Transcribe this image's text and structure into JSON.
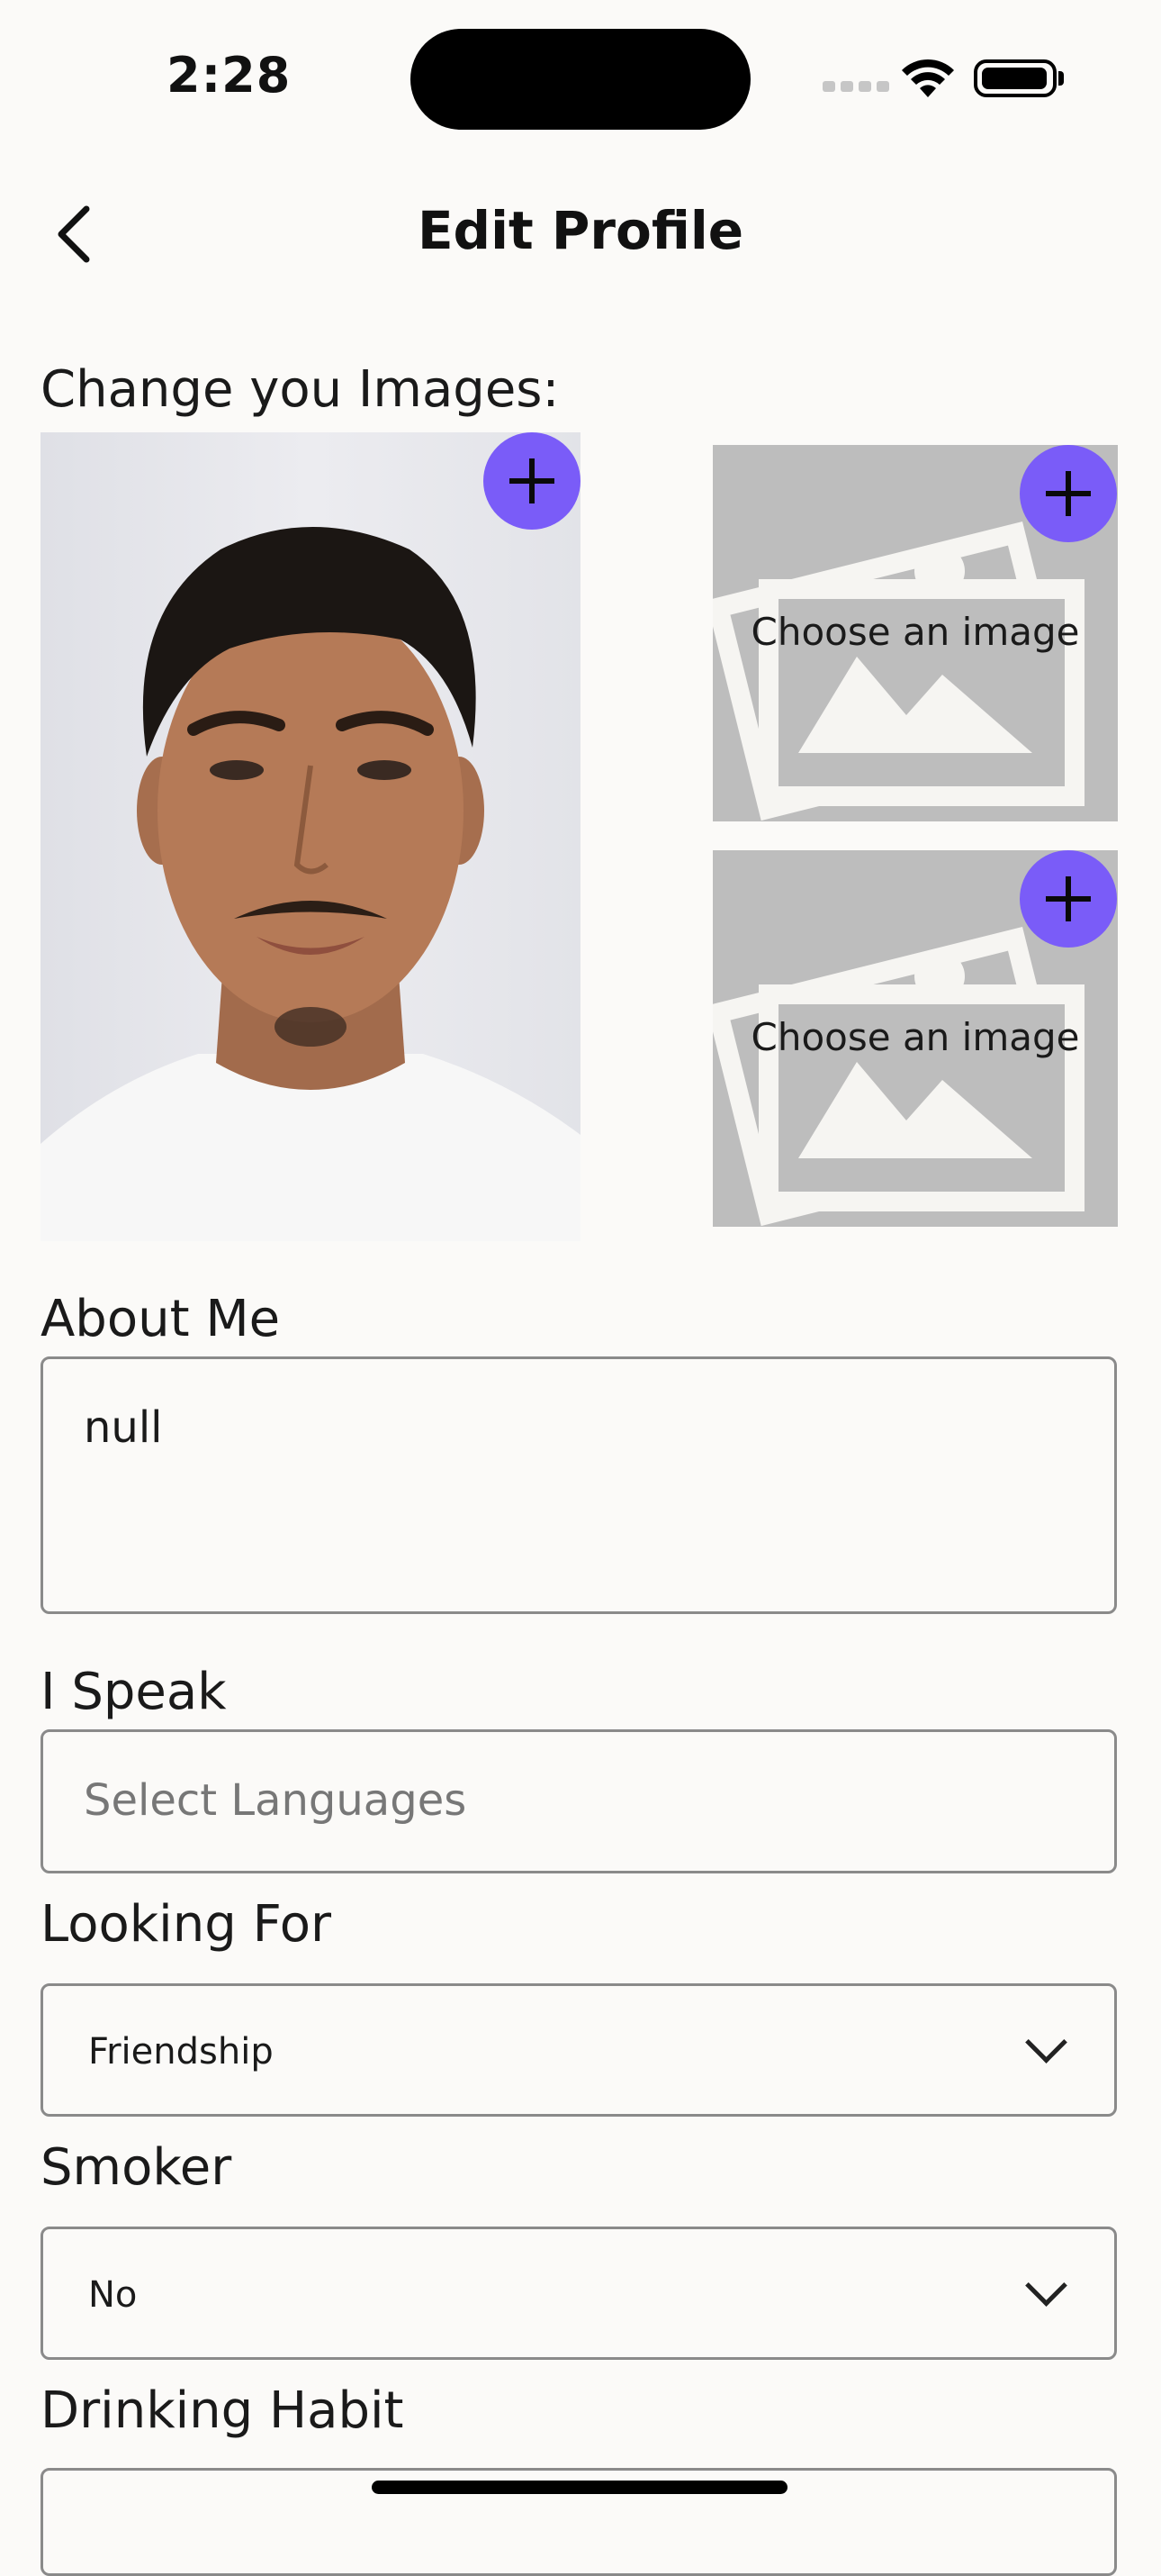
{
  "status_bar": {
    "time": "2:28"
  },
  "header": {
    "title": "Edit Profile",
    "back_icon": "chevron-left-icon"
  },
  "images_section": {
    "label": "Change you Images:",
    "main_photo_alt": "profile photo",
    "slot_placeholder": "Choose an image",
    "add_icon": "plus-icon",
    "accent_color": "#7a5cf8"
  },
  "about_me": {
    "label": "About Me",
    "value": "null"
  },
  "i_speak": {
    "label": "I Speak",
    "placeholder": "Select Languages"
  },
  "looking_for": {
    "label": "Looking For",
    "value": "Friendship"
  },
  "smoker": {
    "label": "Smoker",
    "value": "No"
  },
  "drinking_habit": {
    "label": "Drinking Habit"
  }
}
